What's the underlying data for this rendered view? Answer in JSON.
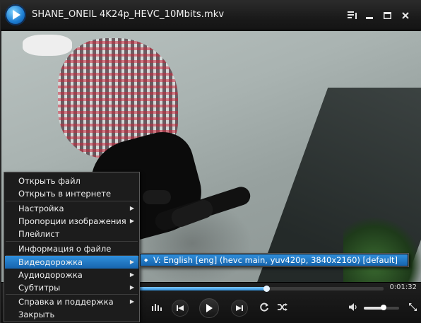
{
  "window": {
    "title": "SHANE_ONEIL 4K24p_HEVC_10Mbits.mkv"
  },
  "titlebar": {
    "buttons": [
      {
        "name": "playlist-icon",
        "glyph": "☰"
      },
      {
        "name": "minimize-icon",
        "glyph": "▁"
      },
      {
        "name": "maximize-icon",
        "glyph": "□"
      },
      {
        "name": "close-icon",
        "glyph": "✕"
      }
    ]
  },
  "player": {
    "elapsed": "0:01:32",
    "seek_fraction": 0.69,
    "volume_fraction": 0.55
  },
  "menu": {
    "items": [
      {
        "label": "Открыть файл",
        "arrow": false,
        "active": false
      },
      {
        "label": "Открыть в интернете",
        "arrow": false,
        "active": false
      },
      {
        "label": "Настройка",
        "arrow": true,
        "active": false
      },
      {
        "label": "Пропорции изображения",
        "arrow": true,
        "active": false
      },
      {
        "label": "Плейлист",
        "arrow": false,
        "active": false
      },
      {
        "label": "Информация о файле",
        "arrow": false,
        "active": false
      },
      {
        "label": "Видеодорожка",
        "arrow": true,
        "active": true
      },
      {
        "label": "Аудиодорожка",
        "arrow": true,
        "active": false
      },
      {
        "label": "Субтитры",
        "arrow": true,
        "active": false
      },
      {
        "label": "Справка и поддержка",
        "arrow": true,
        "active": false
      },
      {
        "label": "Закрыть",
        "arrow": false,
        "active": false
      }
    ]
  },
  "submenu": {
    "items": [
      {
        "label": "V: English [eng] (hevc main, yuv420p, 3840x2160) [default]",
        "selected": true
      }
    ]
  },
  "colors": {
    "accent": "#2f8fdc",
    "menu_bg": "#1c1c1c"
  }
}
